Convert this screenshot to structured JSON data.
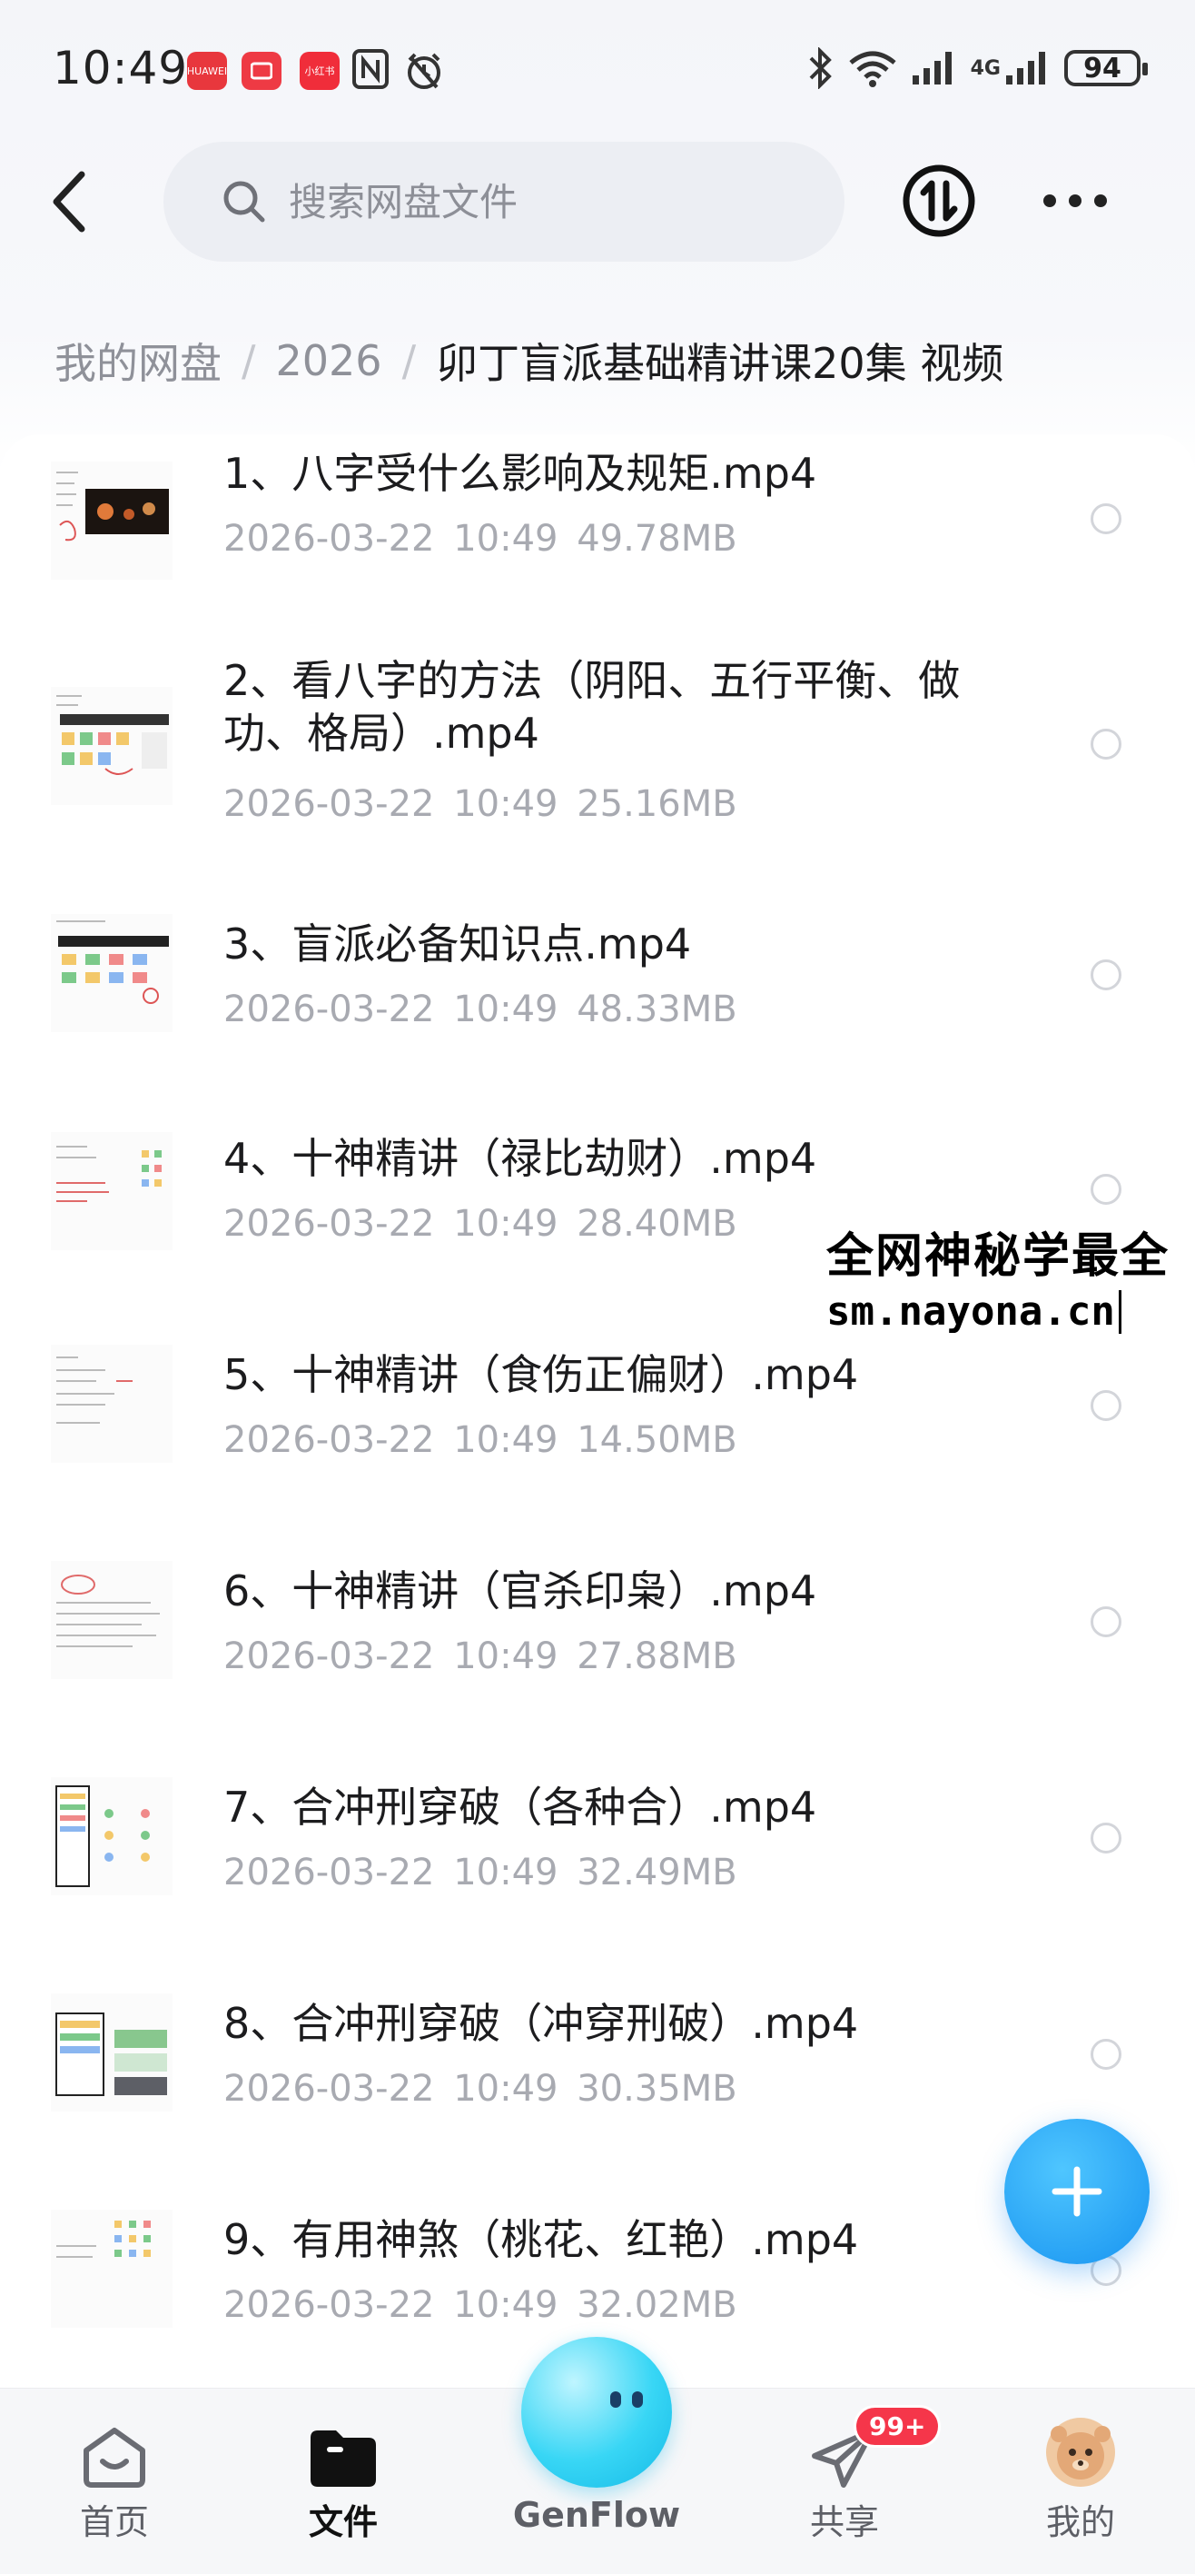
{
  "status_bar": {
    "time": "10:49",
    "apps": [
      {
        "name": "huawei-app-icon",
        "label": "HUAWEI"
      },
      {
        "name": "red-app-icon",
        "label": ""
      },
      {
        "name": "xiaohongshu-app-icon",
        "label": "小红书"
      }
    ],
    "network": "4G",
    "battery": "94"
  },
  "header": {
    "search_placeholder": "搜索网盘文件"
  },
  "breadcrumb": {
    "items": [
      "我的网盘",
      "2026",
      "卯丁盲派基础精讲课20集 视频"
    ]
  },
  "files": [
    {
      "name": "1、八字受什么影响及规矩.mp4",
      "date": "2026-03-22",
      "time": "10:49",
      "size": "49.78MB"
    },
    {
      "name": "2、看八字的方法（阴阳、五行平衡、做功、格局）.mp4",
      "date": "2026-03-22",
      "time": "10:49",
      "size": "25.16MB"
    },
    {
      "name": "3、盲派必备知识点.mp4",
      "date": "2026-03-22",
      "time": "10:49",
      "size": "48.33MB"
    },
    {
      "name": "4、十神精讲（禄比劫财）.mp4",
      "date": "2026-03-22",
      "time": "10:49",
      "size": "28.40MB"
    },
    {
      "name": "5、十神精讲（食伤正偏财）.mp4",
      "date": "2026-03-22",
      "time": "10:49",
      "size": "14.50MB"
    },
    {
      "name": "6、十神精讲（官杀印枭）.mp4",
      "date": "2026-03-22",
      "time": "10:49",
      "size": "27.88MB"
    },
    {
      "name": "7、合冲刑穿破（各种合）.mp4",
      "date": "2026-03-22",
      "time": "10:49",
      "size": "32.49MB"
    },
    {
      "name": "8、合冲刑穿破（冲穿刑破）.mp4",
      "date": "2026-03-22",
      "time": "10:49",
      "size": "30.35MB"
    },
    {
      "name": "9、有用神煞（桃花、红艳）.mp4",
      "date": "2026-03-22",
      "time": "10:49",
      "size": "32.02MB"
    }
  ],
  "watermark": {
    "line1": "全网神秘学最全",
    "line2": "sm.nayona.cn"
  },
  "bottom_nav": {
    "items": [
      {
        "label": "首页",
        "icon": "home-icon"
      },
      {
        "label": "文件",
        "icon": "folder-icon",
        "active": true
      },
      {
        "label": "GenFlow",
        "icon": "genflow-orb-icon"
      },
      {
        "label": "共享",
        "icon": "paper-plane-icon",
        "badge": "99+"
      },
      {
        "label": "我的",
        "icon": "avatar"
      }
    ]
  },
  "colors": {
    "accent": "#1793f0",
    "badge": "#f5364a",
    "muted_text": "#a8aab1"
  }
}
